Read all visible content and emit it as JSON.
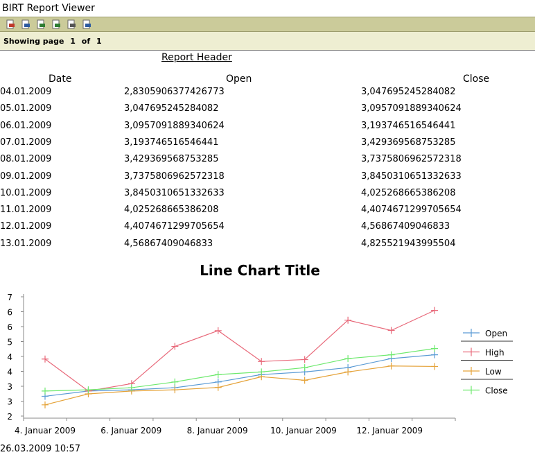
{
  "window": {
    "title": "BIRT Report Viewer"
  },
  "toolbar": {
    "buttons": [
      {
        "name": "toc-icon",
        "color": "#c0392b"
      },
      {
        "name": "parameters-icon",
        "color": "#2c5aa0"
      },
      {
        "name": "export-data-icon",
        "color": "#2e7d32"
      },
      {
        "name": "export-report-icon",
        "color": "#2e7d32"
      },
      {
        "name": "print-icon",
        "color": "#555555"
      },
      {
        "name": "print-server-icon",
        "color": "#2c5aa0"
      }
    ]
  },
  "paging": {
    "showing": "Showing page",
    "current": "1",
    "of": "of",
    "total": "1"
  },
  "report": {
    "header": "Report Header",
    "columns": {
      "date": "Date",
      "open": "Open",
      "close": "Close"
    },
    "rows": [
      {
        "date": "04.01.2009",
        "open": "2,8305906377426773",
        "close": "3,047695245284082"
      },
      {
        "date": "05.01.2009",
        "open": "3,047695245284082",
        "close": "3,0957091889340624"
      },
      {
        "date": "06.01.2009",
        "open": "3,0957091889340624",
        "close": "3,193746516546441"
      },
      {
        "date": "07.01.2009",
        "open": "3,193746516546441",
        "close": "3,429369568753285"
      },
      {
        "date": "08.01.2009",
        "open": "3,429369568753285",
        "close": "3,7375806962572318"
      },
      {
        "date": "09.01.2009",
        "open": "3,7375806962572318",
        "close": "3,8450310651332633"
      },
      {
        "date": "10.01.2009",
        "open": "3,8450310651332633",
        "close": "4,025268665386208"
      },
      {
        "date": "11.01.2009",
        "open": "4,025268665386208",
        "close": "4,4074671299705654"
      },
      {
        "date": "12.01.2009",
        "open": "4,4074671299705654",
        "close": "4,56867409046833"
      },
      {
        "date": "13.01.2009",
        "open": "4,56867409046833",
        "close": "4,825521943995504"
      }
    ],
    "footer_time": "26.03.2009 10:57"
  },
  "chart_data": {
    "type": "line",
    "title": "Line Chart Title",
    "xlabel": "",
    "ylabel": "",
    "x": [
      "04.01.2009",
      "05.01.2009",
      "06.01.2009",
      "07.01.2009",
      "08.01.2009",
      "09.01.2009",
      "10.01.2009",
      "11.01.2009",
      "12.01.2009",
      "13.01.2009"
    ],
    "x_tick_labels": [
      "4. Januar 2009",
      "6. Januar 2009",
      "8. Januar 2009",
      "10. Januar 2009",
      "12. Januar 2009"
    ],
    "y_tick_labels": [
      "2",
      "3",
      "3",
      "4",
      "4",
      "5",
      "6",
      "6",
      "7"
    ],
    "ylim": [
      2,
      7
    ],
    "legend_position": "right",
    "grid": false,
    "series": [
      {
        "name": "Open",
        "color": "#5b9bd5",
        "values": [
          2.83,
          3.05,
          3.1,
          3.19,
          3.43,
          3.74,
          3.85,
          4.03,
          4.41,
          4.57
        ]
      },
      {
        "name": "High",
        "color": "#e8697a",
        "values": [
          4.39,
          3.05,
          3.36,
          4.92,
          5.58,
          4.29,
          4.37,
          6.02,
          5.59,
          6.43
        ]
      },
      {
        "name": "Low",
        "color": "#e5a33a",
        "values": [
          2.47,
          2.93,
          3.05,
          3.1,
          3.2,
          3.65,
          3.5,
          3.85,
          4.1,
          4.08
        ]
      },
      {
        "name": "Close",
        "color": "#6ee96e",
        "values": [
          3.05,
          3.1,
          3.19,
          3.43,
          3.74,
          3.85,
          4.03,
          4.41,
          4.57,
          4.83
        ]
      }
    ]
  }
}
